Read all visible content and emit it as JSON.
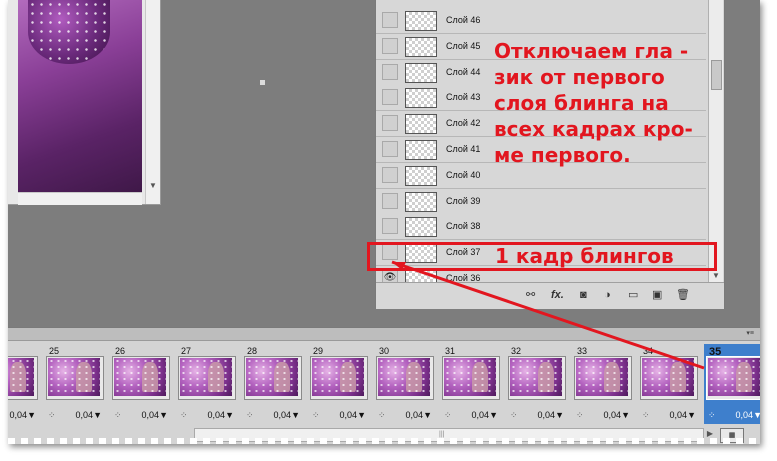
{
  "layers_panel": {
    "layers": [
      {
        "name": "Слой 46",
        "visible": false
      },
      {
        "name": "Слой 45",
        "visible": false
      },
      {
        "name": "Слой 44",
        "visible": false
      },
      {
        "name": "Слой 43",
        "visible": false
      },
      {
        "name": "Слой 42",
        "visible": false
      },
      {
        "name": "Слой 41",
        "visible": false
      },
      {
        "name": "Слой 40",
        "visible": false
      },
      {
        "name": "Слой 39",
        "visible": false
      },
      {
        "name": "Слой 38",
        "visible": false
      },
      {
        "name": "Слой 37",
        "visible": false
      },
      {
        "name": "Слой 36",
        "visible": true
      }
    ],
    "footer_icons": [
      "link-icon",
      "fx-icon",
      "mask-icon",
      "adjustment-icon",
      "group-icon",
      "new-layer-icon",
      "trash-icon"
    ],
    "fx_label": "fx."
  },
  "annotation": {
    "lines": [
      "Отключаем гла -",
      "зик от первого",
      "слоя блинга на",
      "всех кадрах кро-",
      "ме первого."
    ],
    "box_label": "1 кадр блингов",
    "color": "#e2161f"
  },
  "timeline": {
    "frames": [
      {
        "number": "",
        "delay": "0,04"
      },
      {
        "number": "25",
        "delay": "0,04"
      },
      {
        "number": "26",
        "delay": "0,04"
      },
      {
        "number": "27",
        "delay": "0,04"
      },
      {
        "number": "28",
        "delay": "0,04"
      },
      {
        "number": "29",
        "delay": "0,04"
      },
      {
        "number": "30",
        "delay": "0,04"
      },
      {
        "number": "31",
        "delay": "0,04"
      },
      {
        "number": "32",
        "delay": "0,04"
      },
      {
        "number": "33",
        "delay": "0,04"
      },
      {
        "number": "34",
        "delay": "0,04"
      },
      {
        "number": "35",
        "delay": "0,04",
        "selected": true
      }
    ],
    "delay_arrow": "▼",
    "selected_color": "#3e7fcc"
  }
}
